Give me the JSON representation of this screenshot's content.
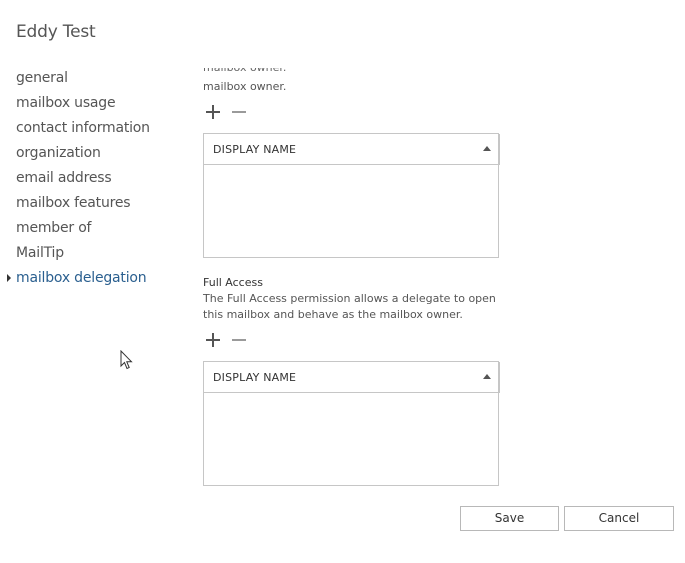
{
  "window": {
    "title": "Eddy Test"
  },
  "nav": {
    "items": [
      {
        "label": "general"
      },
      {
        "label": "mailbox usage"
      },
      {
        "label": "contact information"
      },
      {
        "label": "organization"
      },
      {
        "label": "email address"
      },
      {
        "label": "mailbox features"
      },
      {
        "label": "member of"
      },
      {
        "label": "MailTip"
      },
      {
        "label": "mailbox delegation",
        "selected": true
      }
    ]
  },
  "send_on_behalf": {
    "description_tail": "mailbox owner.",
    "add_icon": "plus-icon",
    "remove_icon": "minus-icon",
    "grid": {
      "column_header": "DISPLAY NAME",
      "rows": []
    }
  },
  "full_access": {
    "title": "Full Access",
    "description_line1": "The Full Access permission allows a delegate to open",
    "description_line2": "this mailbox and behave as the mailbox owner.",
    "add_icon": "plus-icon",
    "remove_icon": "minus-icon",
    "grid": {
      "column_header": "DISPLAY NAME",
      "rows": []
    }
  },
  "footer": {
    "save_label": "Save",
    "cancel_label": "Cancel"
  },
  "colors": {
    "selected_nav": "#2a5f8f",
    "border": "#c6c6c6",
    "text": "#333333"
  }
}
